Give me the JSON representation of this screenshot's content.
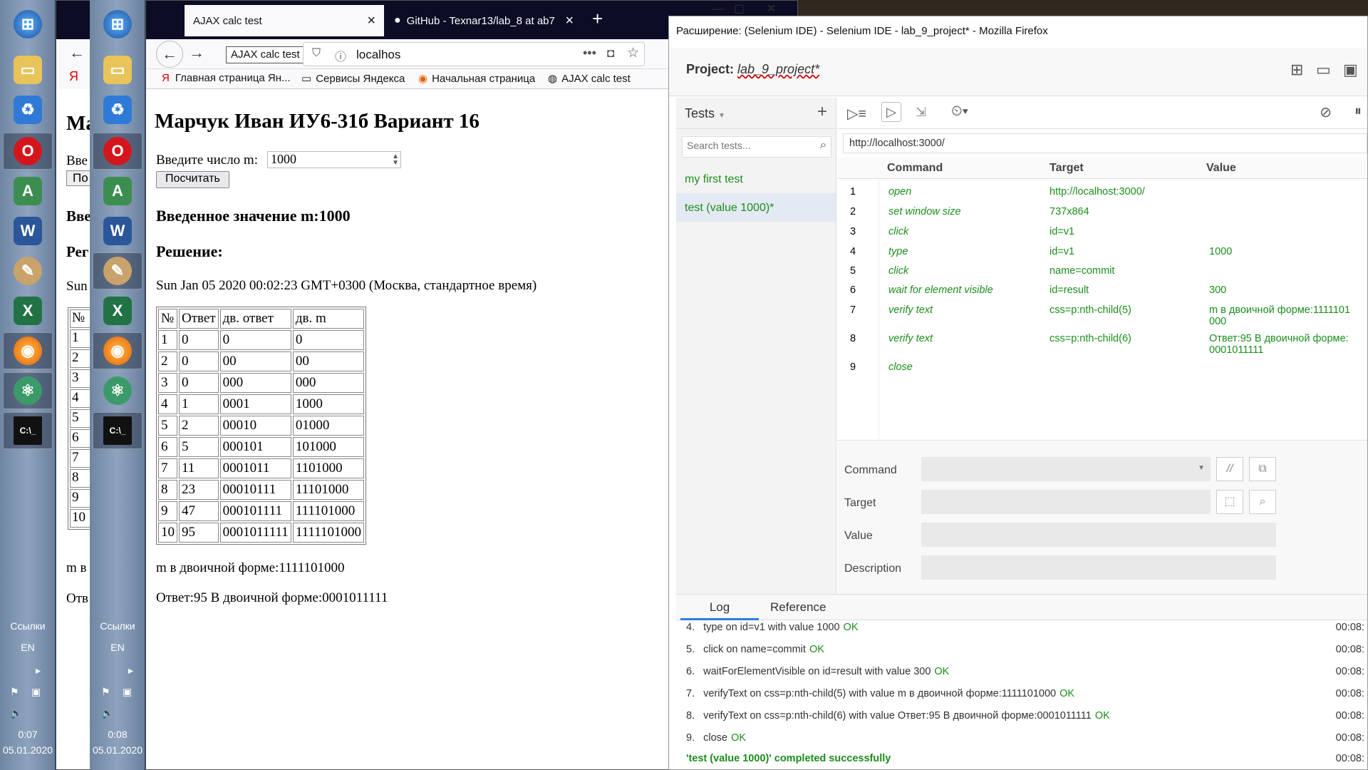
{
  "taskbar1": {
    "links": "Ссылки",
    "lang": "EN",
    "time": "0:07",
    "date": "05.01.2020"
  },
  "taskbar2": {
    "links": "Ссылки",
    "lang": "EN",
    "time": "0:08",
    "date": "05.01.2020"
  },
  "bg_browser": {
    "tab_title": "AJAX calc test",
    "heading_fragment": "Ма",
    "label_fragment": "Вве",
    "btn_fragment": "По",
    "h2_fragment": "Вве",
    "h2b_fragment": "Рег",
    "date_fragment": "Sun",
    "th_no": "№",
    "rows": [
      "1",
      "2",
      "3",
      "4",
      "5",
      "6",
      "7",
      "8",
      "9",
      "10"
    ],
    "m_fragment": "m в",
    "ans_fragment": "Отв"
  },
  "browser": {
    "tabs": [
      {
        "label": "AJAX calc test",
        "close": "×"
      },
      {
        "label": "GitHub - Texnar13/lab_8 at ab7",
        "close": "×"
      }
    ],
    "new_tab": "+",
    "tooltip": "AJAX calc test",
    "url": "localhos",
    "bookmarks": [
      "Главная страница Ян...",
      "Сервисы Яндекса",
      "Начальная страница",
      "AJAX calc test"
    ],
    "page": {
      "title": "Марчук Иван ИУ6-31б Вариант 16",
      "input_label": "Введите число m:",
      "input_value": "1000",
      "button": "Посчитать",
      "entered": "Введенное значение m:1000",
      "solution": "Решение:",
      "datetime": "Sun Jan 05 2020 00:02:23 GMT+0300 (Москва, стандартное время)",
      "headers": [
        "№",
        "Ответ",
        "дв. ответ",
        "дв. m"
      ],
      "rows": [
        [
          "1",
          "0",
          "0",
          "0"
        ],
        [
          "2",
          "0",
          "00",
          "00"
        ],
        [
          "3",
          "0",
          "000",
          "000"
        ],
        [
          "4",
          "1",
          "0001",
          "1000"
        ],
        [
          "5",
          "2",
          "00010",
          "01000"
        ],
        [
          "6",
          "5",
          "000101",
          "101000"
        ],
        [
          "7",
          "11",
          "0001011",
          "1101000"
        ],
        [
          "8",
          "23",
          "00010111",
          "11101000"
        ],
        [
          "9",
          "47",
          "000101111",
          "111101000"
        ],
        [
          "10",
          "95",
          "0001011111",
          "1111101000"
        ]
      ],
      "binary_m": "m в двоичной форме:1111101000",
      "answer": "Ответ:95 В двоичной форме:0001011111"
    }
  },
  "ide": {
    "window_title": "Расширение: (Selenium IDE) - Selenium IDE - lab_9_project* - Mozilla Firefox",
    "project_label": "Project:",
    "project_name": "lab_9_project*",
    "tests_label": "Tests",
    "add": "+",
    "search_placeholder": "Search tests...",
    "tests": [
      "my first test",
      "test (value 1000)*"
    ],
    "base_url": "http://localhost:3000/",
    "col_command": "Command",
    "col_target": "Target",
    "col_value": "Value",
    "commands": [
      {
        "n": "1",
        "cmd": "open",
        "target": "http://localhost:3000/",
        "value": ""
      },
      {
        "n": "2",
        "cmd": "set window size",
        "target": "737x864",
        "value": ""
      },
      {
        "n": "3",
        "cmd": "click",
        "target": "id=v1",
        "value": ""
      },
      {
        "n": "4",
        "cmd": "type",
        "target": "id=v1",
        "value": "1000"
      },
      {
        "n": "5",
        "cmd": "click",
        "target": "name=commit",
        "value": ""
      },
      {
        "n": "6",
        "cmd": "wait for element visible",
        "target": "id=result",
        "value": "300"
      },
      {
        "n": "7",
        "cmd": "verify text",
        "target": "css=p:nth-child(5)",
        "value": "m в двоичной форме:1111101\n000"
      },
      {
        "n": "8",
        "cmd": "verify text",
        "target": "css=p:nth-child(6)",
        "value": "Ответ:95 В двоичной форме:\n0001011111"
      },
      {
        "n": "9",
        "cmd": "close",
        "target": "",
        "value": ""
      }
    ],
    "editor": {
      "command": "Command",
      "target": "Target",
      "value": "Value",
      "description": "Description",
      "comment_btn": "//"
    },
    "log_tab": "Log",
    "reference_tab": "Reference",
    "log": [
      {
        "n": "4.",
        "text": "type on id=v1 with value 1000",
        "ok": "OK",
        "time": "00:08:"
      },
      {
        "n": "5.",
        "text": "click on name=commit",
        "ok": "OK",
        "time": "00:08:"
      },
      {
        "n": "6.",
        "text": "waitForElementVisible on id=result with value 300",
        "ok": "OK",
        "time": "00:08:"
      },
      {
        "n": "7.",
        "text": "verifyText on css=p:nth-child(5) with value m в двоичной форме:1111101000",
        "ok": "OK",
        "time": "00:08:"
      },
      {
        "n": "8.",
        "text": "verifyText on css=p:nth-child(6) with value Ответ:95 В двоичной форме:0001011111",
        "ok": "OK",
        "time": "00:08:"
      },
      {
        "n": "9.",
        "text": "close",
        "ok": "OK",
        "time": "00:08:"
      }
    ],
    "status": "'test (value 1000)' completed successfully",
    "status_time": "00:08:"
  },
  "colors": {
    "accent_green": "#1c8d1c",
    "tab_dark": "#0c0c24"
  }
}
